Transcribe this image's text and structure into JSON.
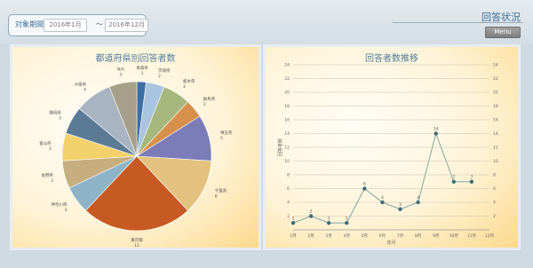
{
  "header": {
    "period_label": "対象期間",
    "start_value": "2016年1月",
    "separator": "～",
    "end_value": "2016年12月",
    "page_title": "回答状況",
    "menu_label": "Menu"
  },
  "chart_data": [
    {
      "type": "pie",
      "title": "都道府県別回答者数",
      "slices": [
        {
          "label": "青森県",
          "value": 1,
          "color": "#3e6fa3"
        },
        {
          "label": "茨城県",
          "value": 2,
          "color": "#a9c4de"
        },
        {
          "label": "栃木県",
          "value": 3,
          "color": "#a5b77c"
        },
        {
          "label": "群馬県",
          "value": 2,
          "color": "#d7904b"
        },
        {
          "label": "埼玉県",
          "value": 5,
          "color": "#7b7cb8"
        },
        {
          "label": "千葉県",
          "value": 6,
          "color": "#e2c27e"
        },
        {
          "label": "東京都",
          "value": 12,
          "color": "#c65a22"
        },
        {
          "label": "神奈川県",
          "value": 3,
          "color": "#8eb3c6"
        },
        {
          "label": "長野県",
          "value": 3,
          "color": "#c6ae7e"
        },
        {
          "label": "富山県",
          "value": 3,
          "color": "#f2d16a"
        },
        {
          "label": "静岡県",
          "value": 3,
          "color": "#5b7a96"
        },
        {
          "label": "大阪府",
          "value": 4,
          "color": "#a8b4c2"
        },
        {
          "label": "N/A",
          "value": 3,
          "color": "#a6a08a"
        }
      ]
    },
    {
      "type": "line",
      "title": "回答者数推移",
      "x": [
        "1月",
        "2月",
        "3月",
        "4月",
        "5月",
        "6月",
        "7月",
        "8月",
        "9月",
        "10月",
        "11月",
        "12月"
      ],
      "series": [
        {
          "values": [
            1,
            2,
            1,
            1,
            6,
            4,
            3,
            4,
            14,
            7,
            7,
            null
          ],
          "color": "#3d6c7a"
        }
      ],
      "xlabel": "年月",
      "ylabel": "回答者数",
      "ylim": [
        0,
        24
      ],
      "yticks": [
        2,
        4,
        6,
        8,
        10,
        12,
        14,
        16,
        18,
        20,
        22,
        24
      ],
      "grid": true
    }
  ]
}
